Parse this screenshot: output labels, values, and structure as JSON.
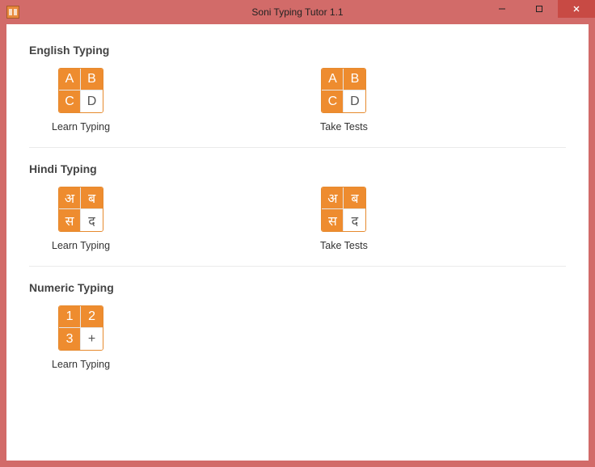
{
  "window": {
    "title": "Soni Typing Tutor 1.1"
  },
  "sections": {
    "english": {
      "title": "English Typing",
      "learn": {
        "label": "Learn Typing",
        "cells": [
          "A",
          "B",
          "C",
          "D"
        ]
      },
      "test": {
        "label": "Take Tests",
        "cells": [
          "A",
          "B",
          "C",
          "D"
        ]
      }
    },
    "hindi": {
      "title": "Hindi Typing",
      "learn": {
        "label": "Learn Typing",
        "cells": [
          "अ",
          "ब",
          "स",
          "द"
        ]
      },
      "test": {
        "label": "Take Tests",
        "cells": [
          "अ",
          "ब",
          "स",
          "द"
        ]
      }
    },
    "numeric": {
      "title": "Numeric Typing",
      "learn": {
        "label": "Learn Typing",
        "cells": [
          "1",
          "2",
          "3",
          "+"
        ]
      }
    }
  }
}
